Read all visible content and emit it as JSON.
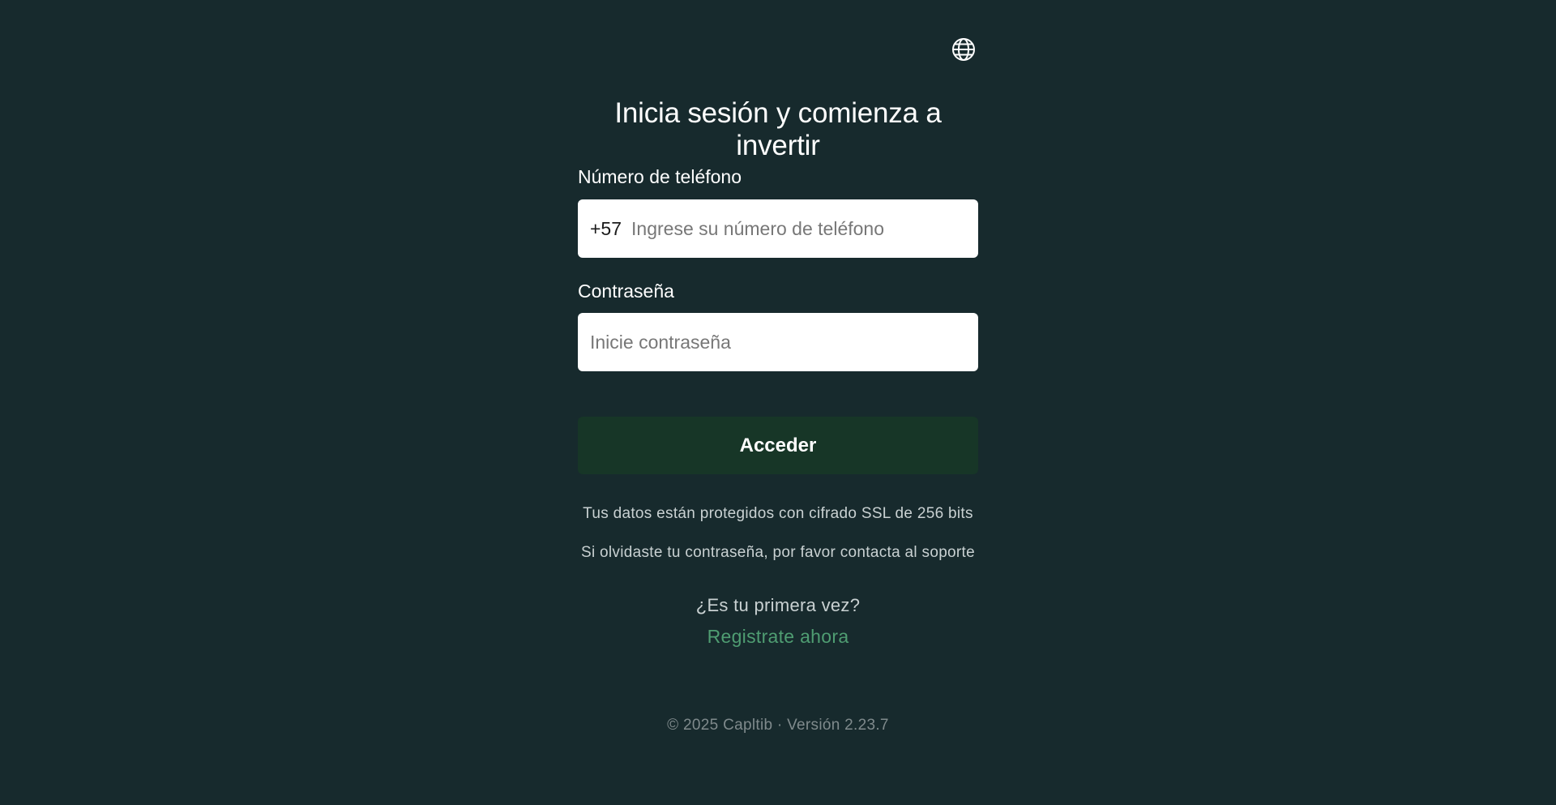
{
  "header": {
    "language_icon": "globe-icon"
  },
  "login": {
    "title": "Inicia sesión y comienza a invertir",
    "phone_label": "Número de teléfono",
    "phone_prefix": "+57",
    "phone_placeholder": "Ingrese su número de teléfono",
    "phone_value": "",
    "password_label": "Contraseña",
    "password_placeholder": "Inicie contraseña",
    "password_value": "",
    "submit_label": "Acceder",
    "ssl_note": "Tus datos están protegidos con cifrado SSL de 256 bits",
    "forgot_note": "Si olvidaste tu contraseña, por favor contacta al soporte",
    "first_time": "¿Es tu primera vez?",
    "register_link": "Registrate ahora"
  },
  "footer": {
    "text": "© 2025 Capltib · Versión 2.23.7"
  },
  "colors": {
    "background": "#172a2d",
    "button": "#173627",
    "link": "#4f9d72"
  }
}
